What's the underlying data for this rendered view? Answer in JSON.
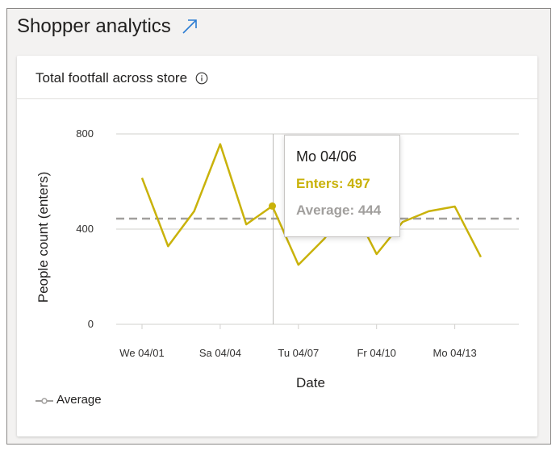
{
  "header": {
    "title": "Shopper analytics",
    "expand_icon": "arrow-up-right-icon"
  },
  "card": {
    "title": "Total footfall across store",
    "info_icon": "info-icon"
  },
  "colors": {
    "enters": "#c9b20a",
    "average": "#a19f9d",
    "grid": "#d2d0ce",
    "crosshair": "#bdbbb8"
  },
  "tooltip": {
    "date": "Mo 04/06",
    "enters_text": "Enters: 497",
    "average_text": "Average: 444"
  },
  "legend": {
    "label": "Average"
  },
  "chart_data": {
    "type": "line",
    "xlabel": "Date",
    "ylabel": "People count (enters)",
    "ylim": [
      0,
      800
    ],
    "yticks": [
      0,
      400,
      800
    ],
    "x": [
      "04/01",
      "04/02",
      "04/03",
      "04/04",
      "04/05",
      "04/06",
      "04/07",
      "04/08",
      "04/09",
      "04/10",
      "04/11",
      "04/12",
      "04/13",
      "04/14"
    ],
    "x_tick_labels": [
      {
        "index": 0,
        "label": "We 04/01"
      },
      {
        "index": 3,
        "label": "Sa 04/04"
      },
      {
        "index": 6,
        "label": "Tu 04/07"
      },
      {
        "index": 9,
        "label": "Fr 04/10"
      },
      {
        "index": 12,
        "label": "Mo 04/13"
      }
    ],
    "series": [
      {
        "name": "Enters",
        "values": [
          615,
          328,
          475,
          757,
          420,
          497,
          250,
          360,
          510,
          295,
          430,
          475,
          495,
          283
        ]
      },
      {
        "name": "Average",
        "values": [
          444,
          444,
          444,
          444,
          444,
          444,
          444,
          444,
          444,
          444,
          444,
          444,
          444,
          444
        ],
        "style": "dashed"
      }
    ],
    "highlight_index": 5,
    "grid": true
  }
}
